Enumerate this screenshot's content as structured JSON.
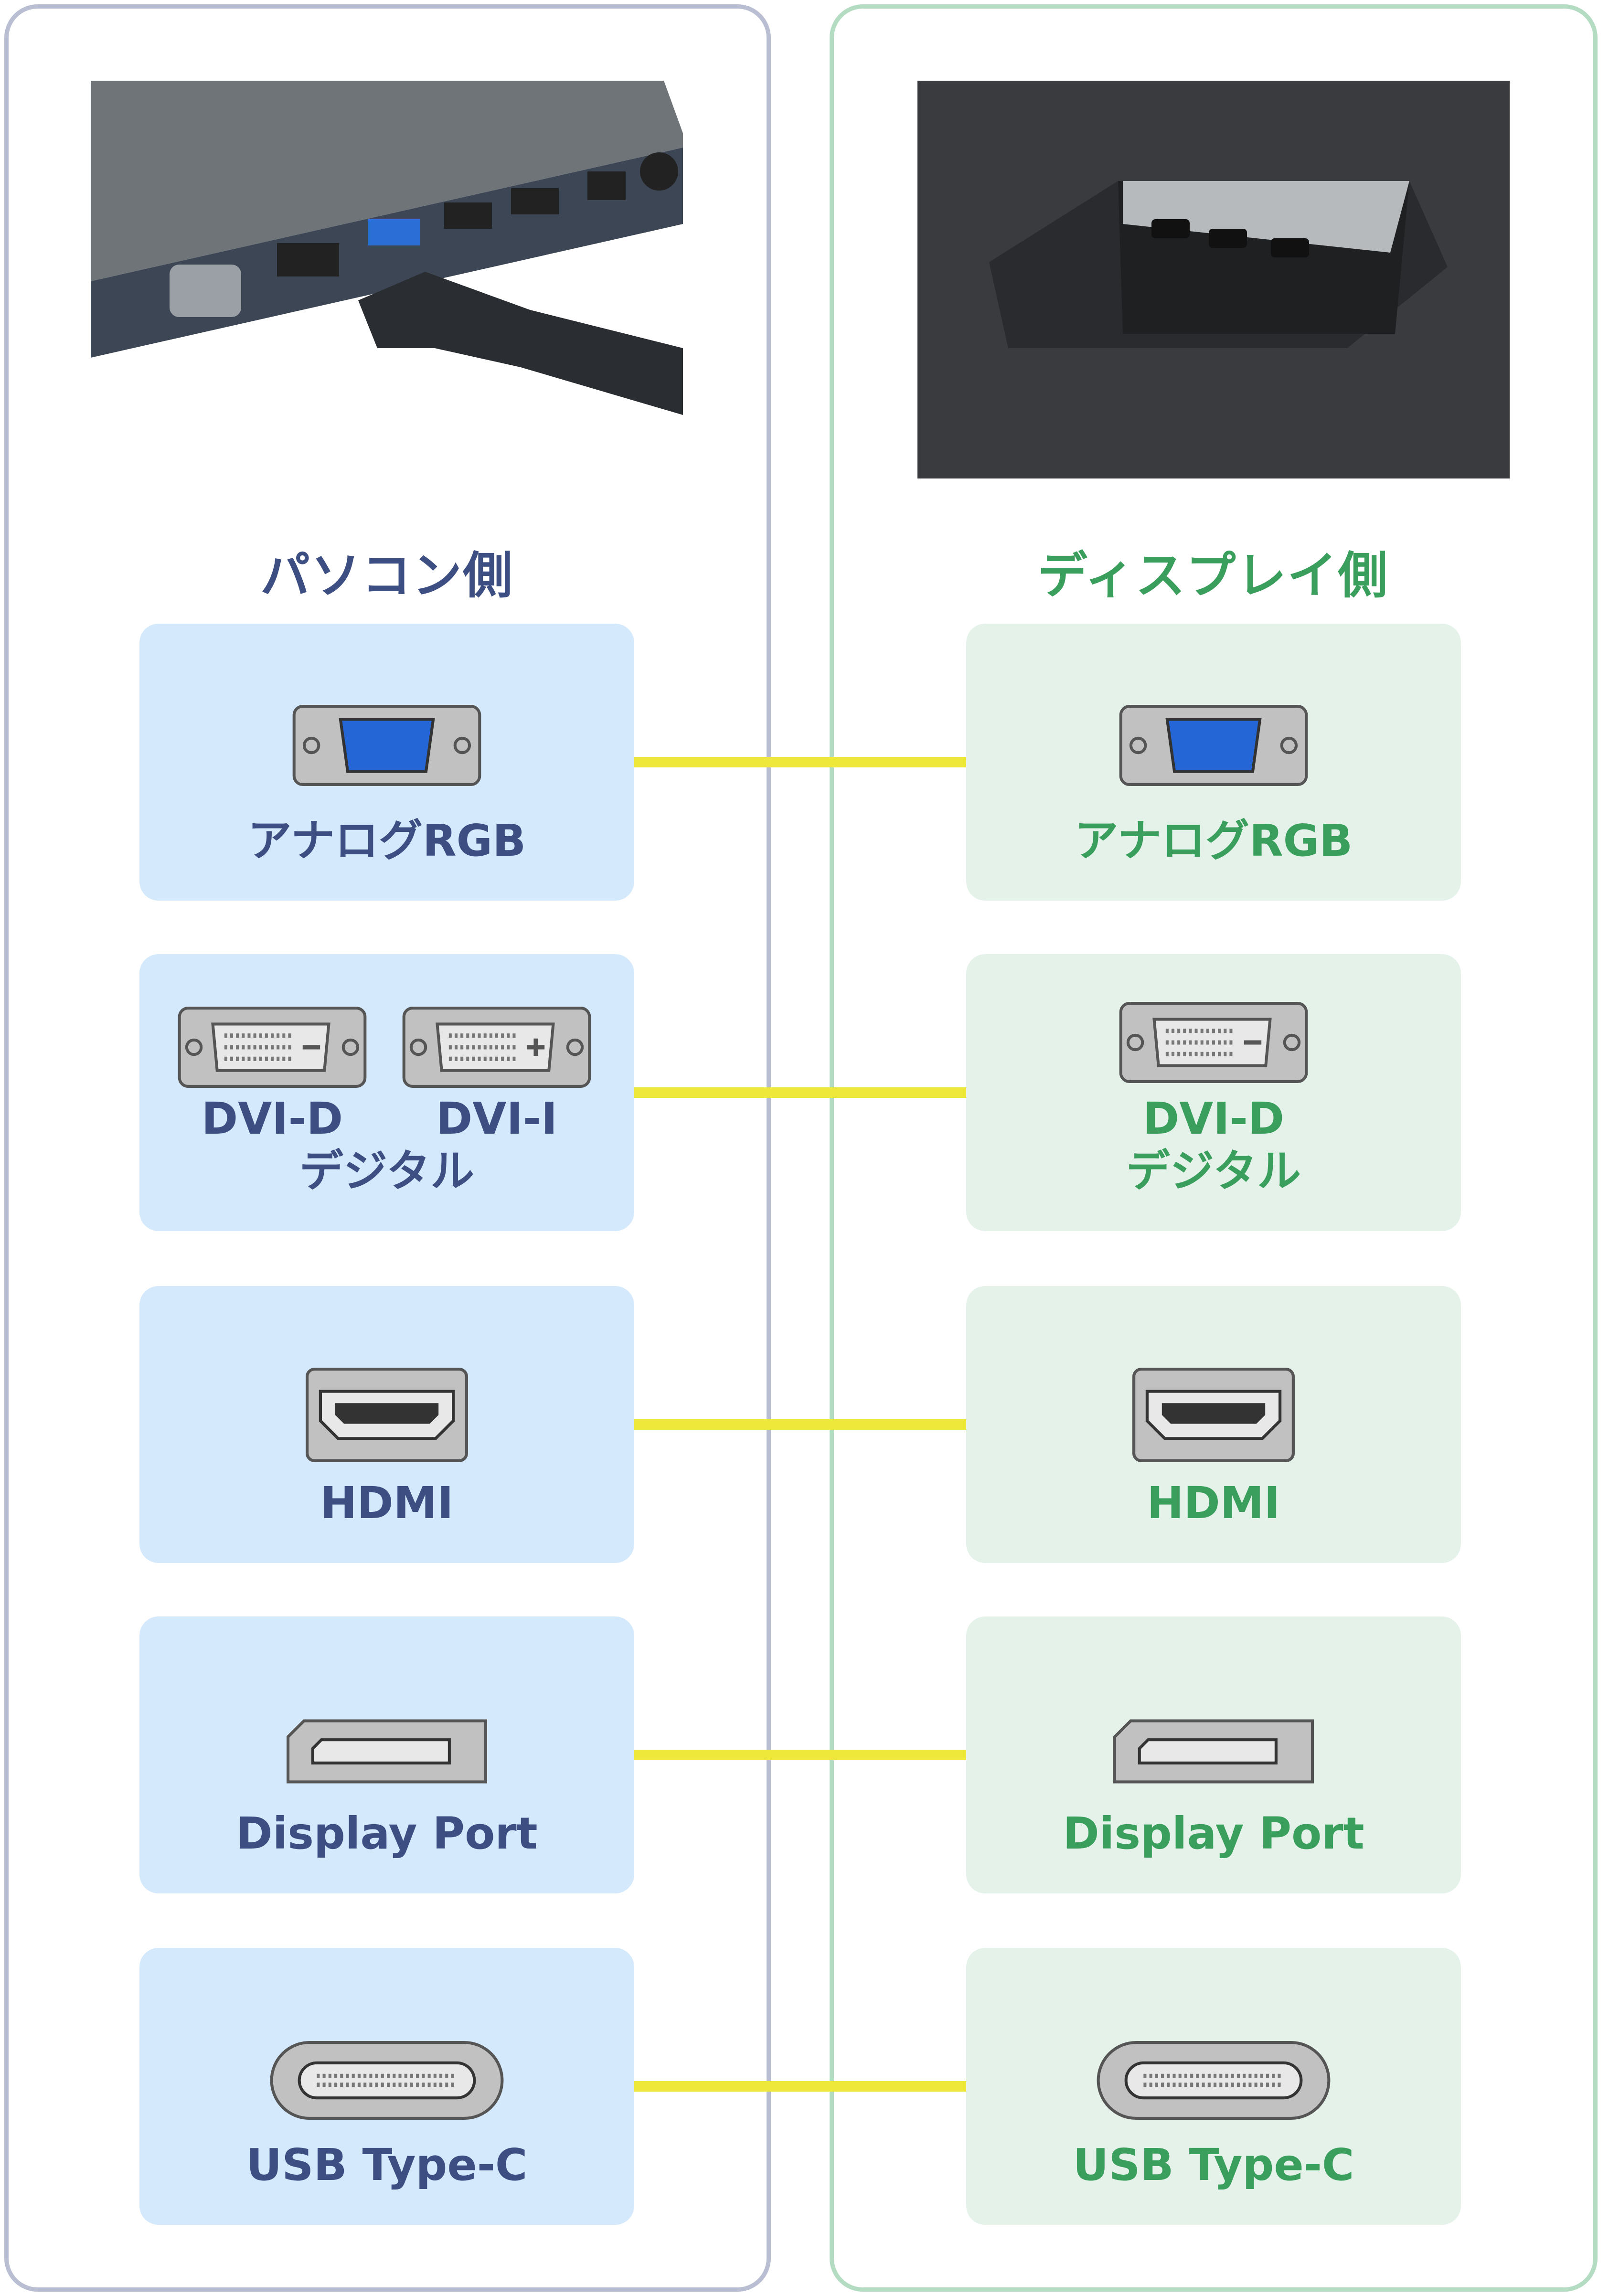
{
  "left": {
    "heading": "パソコン側",
    "color": "#3d4f82",
    "rows": [
      {
        "icon": "vga",
        "labels": [
          "アナログRGB"
        ]
      },
      {
        "icon": "dvi-pair",
        "labels": [
          "DVI-D",
          "DVI-I",
          "デジタル"
        ]
      },
      {
        "icon": "hdmi",
        "labels": [
          "HDMI"
        ]
      },
      {
        "icon": "displayport",
        "labels": [
          "Display Port"
        ]
      },
      {
        "icon": "usb-c",
        "labels": [
          "USB Type-C"
        ]
      }
    ]
  },
  "right": {
    "heading": "ディスプレイ側",
    "color": "#3a9e5c",
    "rows": [
      {
        "icon": "vga",
        "labels": [
          "アナログRGB"
        ]
      },
      {
        "icon": "dvi-d",
        "labels": [
          "DVI-D",
          "デジタル"
        ]
      },
      {
        "icon": "hdmi",
        "labels": [
          "HDMI"
        ]
      },
      {
        "icon": "displayport",
        "labels": [
          "Display Port"
        ]
      },
      {
        "icon": "usb-c",
        "labels": [
          "USB Type-C"
        ]
      }
    ]
  },
  "connector_line_color": "#ede83a"
}
